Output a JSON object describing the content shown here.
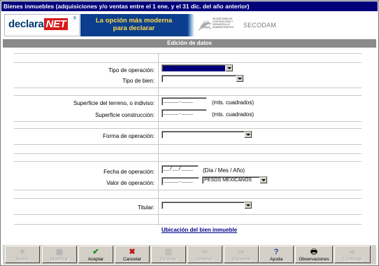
{
  "window": {
    "title": "Bienes inmuebles (adquisiciones y/o ventas entre el 1 ene. y el 31 dic. del año anterior)"
  },
  "banner": {
    "logo_text": "declara",
    "logo_net": "NET",
    "slogan_line1": "La opción más moderna",
    "slogan_line2": "para declarar",
    "agency": "SECODAM",
    "agency_small": "SECRETARIA DE CONTRALORIA Y DESARROLLO ADMINISTRATIVO"
  },
  "section_title": "Edición de datos",
  "form": {
    "tipo_operacion": {
      "label": "Tipo de operación:",
      "value": ""
    },
    "tipo_bien": {
      "label": "Tipo de bien:",
      "value": ""
    },
    "superficie_terreno": {
      "label": "Superficie del terreno, o indiviso:",
      "value": "_____.____",
      "unit": "(mts. cuadrados)"
    },
    "superficie_construccion": {
      "label": "Superficie construcción:",
      "value": "_____.____",
      "unit": "(mts. cuadrados)"
    },
    "forma_operacion": {
      "label": "Forma de operación:",
      "value": ""
    },
    "fecha_operacion": {
      "label": "Fecha de operación:",
      "value": "__/__/____",
      "unit": "(Día / Mes / Año)"
    },
    "valor_operacion": {
      "label": "Valor de operación:",
      "value": "_____.____",
      "currency": "PESOS MEXICANOS"
    },
    "titular": {
      "label": "Titular:",
      "value": ""
    },
    "ubicacion_link": "Ubicación del bien inmueble"
  },
  "toolbar": {
    "nuevo": "Nuevo",
    "modificar": "Modificar",
    "aceptar": "Aceptar",
    "cancelar": "Cancelar",
    "eliminar": "Eliminar",
    "anterior": "Anterior",
    "siguiente": "Siguiente",
    "ayuda": "Ayuda",
    "observaciones": "Observaciones",
    "continuar": "Continuar"
  },
  "colors": {
    "title_bar": "#00007b",
    "header_bar": "#8a8a8a",
    "accept": "#1a8a1a",
    "cancel": "#c01010",
    "link": "#00008b"
  }
}
